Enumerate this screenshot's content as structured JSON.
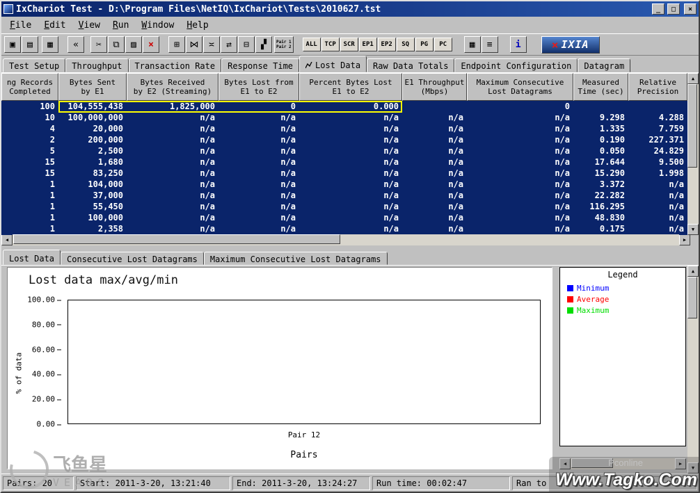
{
  "window": {
    "title": "IxChariot Test - D:\\Program Files\\NetIQ\\IxChariot\\Tests\\2010627.tst",
    "controls": {
      "minimize": "_",
      "maximize": "□",
      "close": "×"
    }
  },
  "menu": {
    "items": [
      "File",
      "Edit",
      "View",
      "Run",
      "Window",
      "Help"
    ]
  },
  "toolbar": {
    "buttons": [
      {
        "name": "save-button",
        "glyph": "▣"
      },
      {
        "name": "print-button",
        "glyph": "▤"
      },
      {
        "name": "edit-grid-button",
        "glyph": "▦",
        "gap": 4
      },
      {
        "name": "rewind-button",
        "glyph": "«",
        "gap": 12
      },
      {
        "name": "cut-button",
        "glyph": "✂",
        "gap": 8
      },
      {
        "name": "copy-button",
        "glyph": "⧉"
      },
      {
        "name": "paste-button",
        "glyph": "▨"
      },
      {
        "name": "delete-button",
        "glyph": "×",
        "color": "#cc0000"
      },
      {
        "name": "add-pair-button",
        "glyph": "⊞",
        "gap": 12
      },
      {
        "name": "pair-link-button",
        "glyph": "⋈"
      },
      {
        "name": "pair-copy-button",
        "glyph": "≍"
      },
      {
        "name": "pair-swap-button",
        "glyph": "⇄"
      },
      {
        "name": "pair-group-button",
        "glyph": "⊟"
      },
      {
        "name": "pair-view-button",
        "glyph": "▞"
      },
      {
        "name": "pair-12-button",
        "lines": [
          "Pair 1",
          "Pair 2"
        ],
        "gap": 2
      },
      {
        "name": "filter-all-button",
        "label": "ALL",
        "gap": 12
      },
      {
        "name": "filter-tcp-button",
        "label": "TCP"
      },
      {
        "name": "filter-scr-button",
        "label": "SCR"
      },
      {
        "name": "filter-ep1-button",
        "label": "EP1"
      },
      {
        "name": "filter-ep2-button",
        "label": "EP2"
      },
      {
        "name": "filter-sq-button",
        "label": "SQ"
      },
      {
        "name": "filter-pg-button",
        "label": "PG"
      },
      {
        "name": "filter-pc-button",
        "label": "PC"
      },
      {
        "name": "grid-view-button",
        "glyph": "▦",
        "gap": 16
      },
      {
        "name": "list-view-button",
        "glyph": "≡"
      },
      {
        "name": "help-info-button",
        "glyph": "i",
        "color": "#0000bb",
        "gap": 16
      }
    ],
    "logo": {
      "x": "×",
      "text": "IXIA"
    }
  },
  "tabs": {
    "active_index": 4,
    "items": [
      "Test Setup",
      "Throughput",
      "Transaction Rate",
      "Response Time",
      "Lost Data",
      "Raw Data Totals",
      "Endpoint Configuration",
      "Datagram"
    ]
  },
  "table": {
    "columns": [
      [
        "ng Records",
        "Completed"
      ],
      [
        "Bytes Sent",
        "by E1"
      ],
      [
        "Bytes Received",
        "by E2 (Streaming)"
      ],
      [
        "Bytes Lost from",
        "E1 to E2"
      ],
      [
        "Percent Bytes Lost",
        "E1 to E2"
      ],
      [
        "E1 Throughput",
        "(Mbps)"
      ],
      [
        "Maximum Consecutive",
        "Lost Datagrams"
      ],
      [
        "Measured",
        "Time (sec)"
      ],
      [
        "Relative",
        "Precision"
      ]
    ],
    "rows": [
      [
        "100",
        "104,555,438",
        "1,825,000",
        "0",
        "0.000",
        "",
        "0",
        "",
        ""
      ],
      [
        "10",
        "100,000,000",
        "n/a",
        "n/a",
        "n/a",
        "n/a",
        "n/a",
        "9.298",
        "4.288"
      ],
      [
        "4",
        "20,000",
        "n/a",
        "n/a",
        "n/a",
        "n/a",
        "n/a",
        "1.335",
        "7.759"
      ],
      [
        "2",
        "200,000",
        "n/a",
        "n/a",
        "n/a",
        "n/a",
        "n/a",
        "0.190",
        "227.371"
      ],
      [
        "5",
        "2,500",
        "n/a",
        "n/a",
        "n/a",
        "n/a",
        "n/a",
        "0.050",
        "24.829"
      ],
      [
        "15",
        "1,680",
        "n/a",
        "n/a",
        "n/a",
        "n/a",
        "n/a",
        "17.644",
        "9.500"
      ],
      [
        "15",
        "83,250",
        "n/a",
        "n/a",
        "n/a",
        "n/a",
        "n/a",
        "15.290",
        "1.998"
      ],
      [
        "1",
        "104,000",
        "n/a",
        "n/a",
        "n/a",
        "n/a",
        "n/a",
        "3.372",
        "n/a"
      ],
      [
        "1",
        "37,000",
        "n/a",
        "n/a",
        "n/a",
        "n/a",
        "n/a",
        "22.282",
        "n/a"
      ],
      [
        "1",
        "55,450",
        "n/a",
        "n/a",
        "n/a",
        "n/a",
        "n/a",
        "116.295",
        "n/a"
      ],
      [
        "1",
        "100,000",
        "n/a",
        "n/a",
        "n/a",
        "n/a",
        "n/a",
        "48.830",
        "n/a"
      ],
      [
        "1",
        "2,358",
        "n/a",
        "n/a",
        "n/a",
        "n/a",
        "n/a",
        "0.175",
        "n/a"
      ]
    ]
  },
  "lower_tabs": {
    "active_index": 0,
    "items": [
      "Lost Data",
      "Consecutive Lost Datagrams",
      "Maximum Consecutive Lost Datagrams"
    ]
  },
  "chart_data": {
    "type": "line",
    "title": "Lost data max/avg/min",
    "xlabel": "Pairs",
    "ylabel": "% of data",
    "ylim": [
      0,
      100
    ],
    "yticks": [
      "100.00",
      "80.00",
      "60.00",
      "40.00",
      "20.00",
      "0.00"
    ],
    "xticks": [
      "Pair 12"
    ],
    "grid": false,
    "legend_position": "right",
    "series": [
      {
        "name": "Minimum",
        "color": "#0000ff",
        "values": []
      },
      {
        "name": "Average",
        "color": "#ff0000",
        "values": []
      },
      {
        "name": "Maximum",
        "color": "#00dd00",
        "values": []
      }
    ]
  },
  "legend": {
    "title": "Legend",
    "items": [
      {
        "label": "Minimum",
        "color": "#0000ff"
      },
      {
        "label": "Average",
        "color": "#ff0000"
      },
      {
        "label": "Maximum",
        "color": "#00dd00"
      }
    ]
  },
  "status_bar": {
    "panels": [
      "Pairs: 20",
      "Start: 2011-3-20, 13:21:40",
      "End: 2011-3-20, 13:24:27",
      "Run time: 00:02:47",
      "Ran to"
    ]
  },
  "icons": {
    "scroll_up": "▲",
    "scroll_down": "▼",
    "scroll_left": "◀",
    "scroll_right": "▶"
  },
  "watermarks": {
    "vears_cn": "飞鱼星",
    "vears_en": "VEARS",
    "pconline": "Pconline",
    "tagko": "Www.Tagko.Com"
  },
  "colors": {
    "table_bg": "#0a246a",
    "highlight": "#ffff00"
  }
}
